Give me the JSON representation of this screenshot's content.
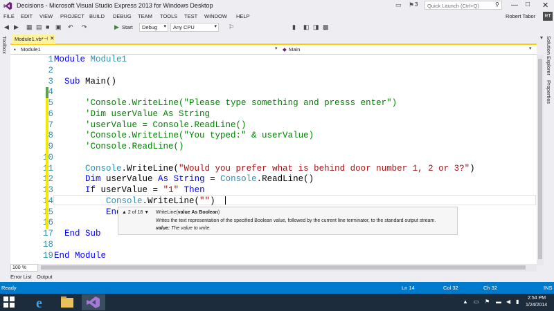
{
  "window": {
    "title": "Decisions - Microsoft Visual Studio Express 2013 for Windows Desktop",
    "notification_count": "3",
    "quick_launch_placeholder": "Quick Launch (Ctrl+Q)",
    "user": "Robert Tabor",
    "user_initials": "RT"
  },
  "menu": [
    "FILE",
    "EDIT",
    "VIEW",
    "PROJECT",
    "BUILD",
    "DEBUG",
    "TEAM",
    "TOOLS",
    "TEST",
    "WINDOW",
    "HELP"
  ],
  "toolbar": {
    "start_label": "Start",
    "config": "Debug",
    "platform": "Any CPU"
  },
  "sidebars": {
    "left": "Toolbox",
    "right_1": "Solution Explorer",
    "right_2": "Properties"
  },
  "tab": {
    "label": "Module1.vb*"
  },
  "navbar": {
    "left": "Module1",
    "right": "Main"
  },
  "editor": {
    "line_numbers": [
      "1",
      "2",
      "3",
      "4",
      "5",
      "6",
      "7",
      "8",
      "9",
      "10",
      "11",
      "12",
      "13",
      "14",
      "15",
      "16",
      "17",
      "18",
      "19"
    ],
    "code": {
      "l1_kw": "Module",
      "l1_name": " Module1",
      "l3_kw": "Sub",
      "l3_rest": " Main()",
      "l5": "'Console.WriteLine(\"Please type something and presss enter\")",
      "l6": "'Dim userValue As String",
      "l7": "'userValue = Console.ReadLine()",
      "l8": "'Console.WriteLine(\"You typed:\" & userValue)",
      "l9": "'Console.ReadLine()",
      "l11_type": "Console",
      "l11_mid": ".WriteLine(",
      "l11_str": "\"Would you prefer what is behind door number 1, 2 or 3?\"",
      "l11_end": ")",
      "l12_kw1": "Dim",
      "l12_mid1": " userValue ",
      "l12_kw2": "As",
      "l12_sp": " ",
      "l12_kw3": "String",
      "l12_eq": " = ",
      "l12_type": "Console",
      "l12_end": ".ReadLine()",
      "l13_kw1": "If",
      "l13_mid": " userValue = ",
      "l13_str": "\"1\"",
      "l13_sp": " ",
      "l13_kw2": "Then",
      "l14_type": "Console",
      "l14_mid": ".WriteLine(",
      "l14_str": "\"\"",
      "l14_end": ")",
      "l15_kw": "End",
      "l17_kw": "End Sub",
      "l19_kw": "End Module"
    },
    "zoom": "100 %"
  },
  "tooltip": {
    "overload": "▲ 2 of 18 ▼",
    "sig_method": "WriteLine(",
    "sig_param": "value As Boolean",
    "sig_close": ")",
    "description": "Writes the text representation of the specified Boolean value, followed by the current line terminator, to the standard output stream.",
    "param_name": "value:",
    "param_desc": " The value to write."
  },
  "bottom_tabs": [
    "Error List",
    "Output"
  ],
  "status": {
    "state": "Ready",
    "line": "Ln 14",
    "col": "Col 32",
    "ch": "Ch 32",
    "mode": "INS"
  },
  "taskbar": {
    "time": "2:54 PM",
    "date": "1/24/2014"
  },
  "colors": {
    "accent": "#007acc",
    "keyword": "#0000ff",
    "comment": "#008000",
    "string": "#a31515",
    "type": "#2b91af",
    "vs_purple": "#68217a"
  }
}
